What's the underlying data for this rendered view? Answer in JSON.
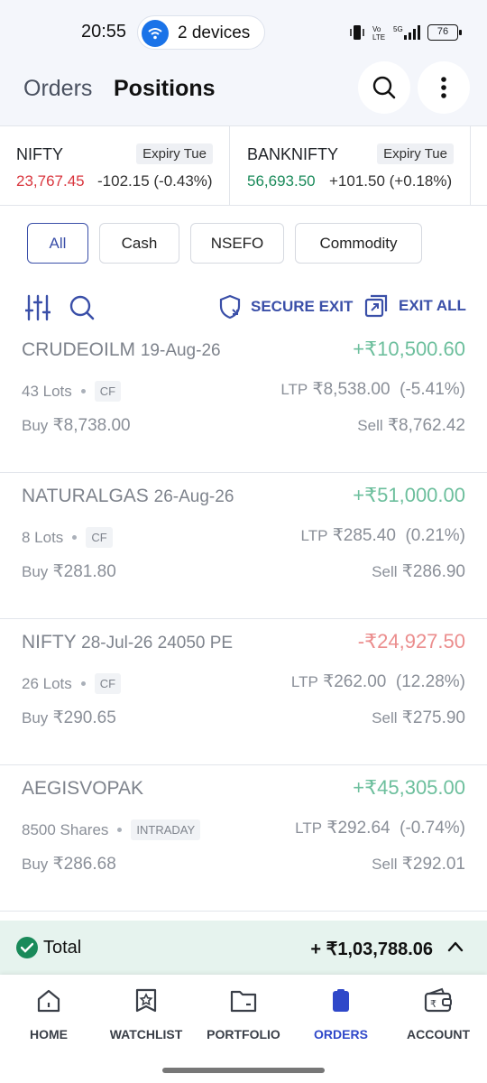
{
  "status_bar": {
    "time": "20:55",
    "devices_label": "2 devices",
    "battery": "76"
  },
  "header": {
    "tab_orders": "Orders",
    "tab_positions": "Positions"
  },
  "indices": [
    {
      "name": "NIFTY",
      "badge": "Expiry Tue",
      "price": "23,767.45",
      "change": "-102.15 (-0.43%)",
      "direction": "down"
    },
    {
      "name": "BANKNIFTY",
      "badge": "Expiry Tue",
      "price": "56,693.50",
      "change": "+101.50 (+0.18%)",
      "direction": "up"
    }
  ],
  "filters": [
    "All",
    "Cash",
    "NSEFO",
    "Commodity"
  ],
  "active_filter": "All",
  "toolbar": {
    "secure_exit": "SECURE EXIT",
    "exit_all": "EXIT ALL"
  },
  "positions": [
    {
      "symbol": "CRUDEOILM",
      "contract": "19-Aug-26",
      "pnl": "+₹10,500.60",
      "pnl_sign": "positive",
      "qty": "43 Lots",
      "tag": "CF",
      "ltp_label": "LTP",
      "ltp": "₹8,538.00",
      "ltp_change": "(-5.41%)",
      "buy_label": "Buy",
      "buy": "₹8,738.00",
      "sell_label": "Sell",
      "sell": "₹8,762.42"
    },
    {
      "symbol": "NATURALGAS",
      "contract": "26-Aug-26",
      "pnl": "+₹51,000.00",
      "pnl_sign": "positive",
      "qty": "8 Lots",
      "tag": "CF",
      "ltp_label": "LTP",
      "ltp": "₹285.40",
      "ltp_change": "(0.21%)",
      "buy_label": "Buy",
      "buy": "₹281.80",
      "sell_label": "Sell",
      "sell": "₹286.90"
    },
    {
      "symbol": "NIFTY",
      "contract": "28-Jul-26 24050 PE",
      "pnl": "-₹24,927.50",
      "pnl_sign": "negative",
      "qty": "26 Lots",
      "tag": "CF",
      "ltp_label": "LTP",
      "ltp": "₹262.00",
      "ltp_change": "(12.28%)",
      "buy_label": "Buy",
      "buy": "₹290.65",
      "sell_label": "Sell",
      "sell": "₹275.90"
    },
    {
      "symbol": "AEGISVOPAK",
      "contract": "",
      "pnl": "+₹45,305.00",
      "pnl_sign": "positive",
      "qty": "8500 Shares",
      "tag": "INTRADAY",
      "ltp_label": "LTP",
      "ltp": "₹292.64",
      "ltp_change": "(-0.74%)",
      "buy_label": "Buy",
      "buy": "₹286.68",
      "sell_label": "Sell",
      "sell": "₹292.01"
    }
  ],
  "total": {
    "label": "Total",
    "value": "+ ₹1,03,788.06"
  },
  "bottom_nav": [
    {
      "label": "HOME",
      "icon": "home-icon"
    },
    {
      "label": "WATCHLIST",
      "icon": "watchlist-icon"
    },
    {
      "label": "PORTFOLIO",
      "icon": "portfolio-icon"
    },
    {
      "label": "ORDERS",
      "icon": "orders-icon"
    },
    {
      "label": "ACCOUNT",
      "icon": "account-icon"
    }
  ],
  "active_nav": "ORDERS",
  "colors": {
    "accent": "#3a4fa8",
    "nav_active": "#2f48c9",
    "profit": "#6dbf9d",
    "loss": "#eb8d8d",
    "index_down": "#d9363e",
    "index_up": "#1a8a5a",
    "total_bg": "#e6f3ee"
  }
}
